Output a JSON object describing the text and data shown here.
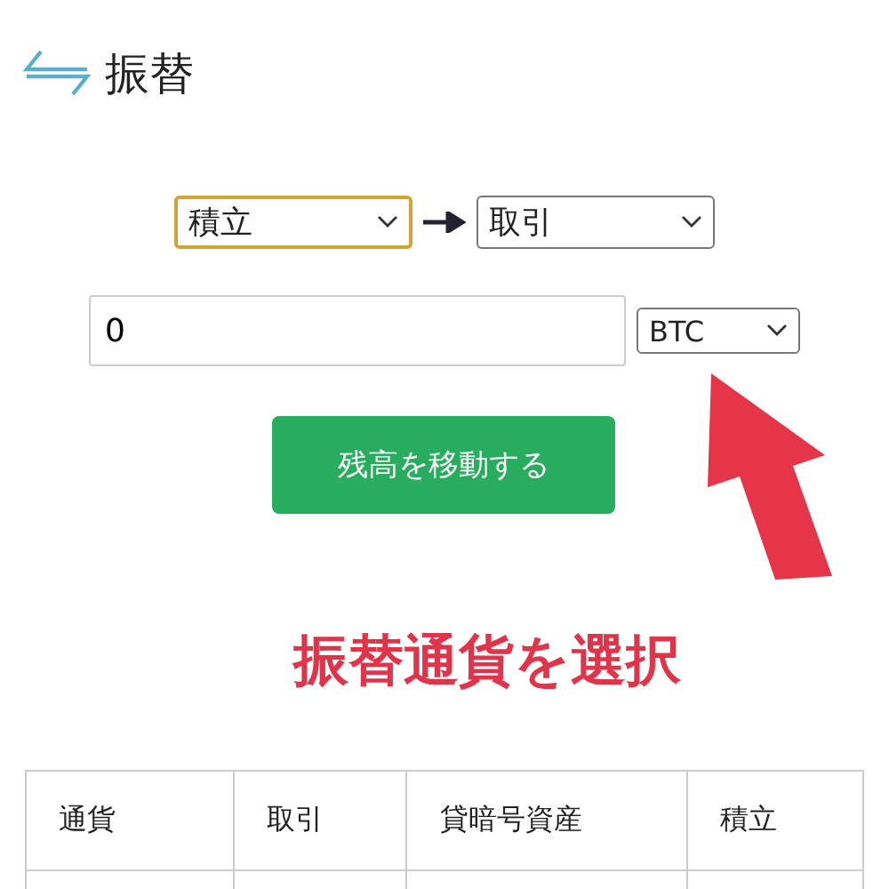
{
  "header": {
    "title": "振替"
  },
  "transfer": {
    "from": {
      "value": "積立",
      "focused": true
    },
    "to": {
      "value": "取引",
      "focused": false
    }
  },
  "amount": {
    "value": "0"
  },
  "currency": {
    "value": "BTC",
    "focused": false
  },
  "submit_button": "残高を移動する",
  "annotation": "振替通貨を選択",
  "table": {
    "columns": [
      "通貨",
      "取引",
      "貸暗号資産",
      "積立"
    ]
  }
}
